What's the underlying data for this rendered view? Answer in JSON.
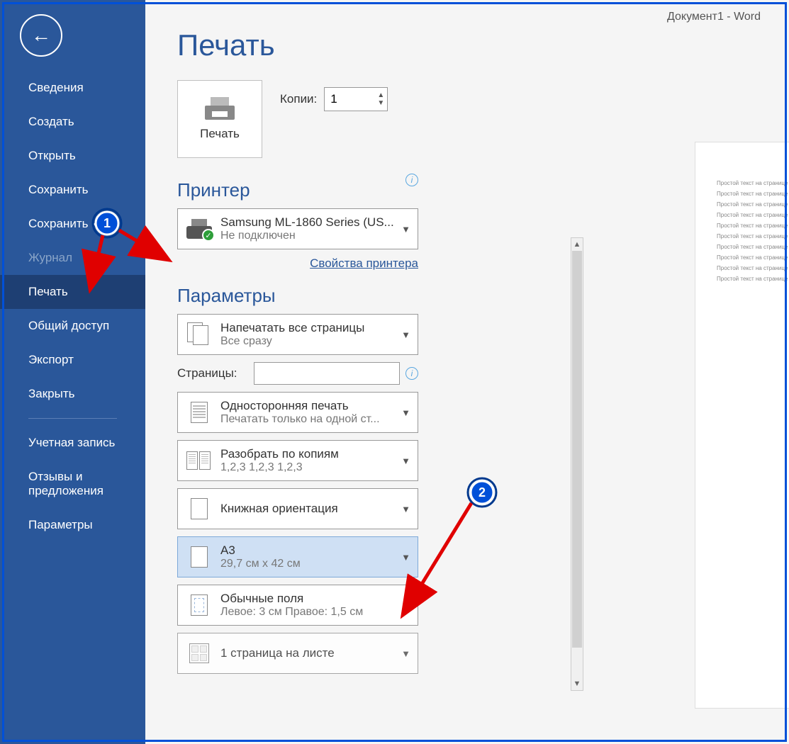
{
  "titlebar": {
    "text": "Документ1  -  Word"
  },
  "page_title": "Печать",
  "sidebar": {
    "items": [
      {
        "label": "Сведения",
        "active": false
      },
      {
        "label": "Создать",
        "active": false
      },
      {
        "label": "Открыть",
        "active": false
      },
      {
        "label": "Сохранить",
        "active": false
      },
      {
        "label": "Сохранить как",
        "active": false
      },
      {
        "label": "Журнал",
        "active": false,
        "disabled": true
      },
      {
        "label": "Печать",
        "active": true
      },
      {
        "label": "Общий доступ",
        "active": false
      },
      {
        "label": "Экспорт",
        "active": false
      },
      {
        "label": "Закрыть",
        "active": false
      }
    ],
    "footer": [
      {
        "label": "Учетная запись"
      },
      {
        "label": "Отзывы и предложения"
      },
      {
        "label": "Параметры"
      }
    ]
  },
  "print_button": {
    "label": "Печать"
  },
  "copies": {
    "label": "Копии:",
    "value": "1"
  },
  "printer_section": {
    "header": "Принтер",
    "name": "Samsung ML-1860 Series (US...",
    "status": "Не подключен",
    "properties_link": "Свойства принтера"
  },
  "settings_section": {
    "header": "Параметры"
  },
  "settings": {
    "print_range": {
      "primary": "Напечатать все страницы",
      "secondary": "Все сразу"
    },
    "pages": {
      "label": "Страницы:",
      "value": ""
    },
    "duplex": {
      "primary": "Односторонняя печать",
      "secondary": "Печатать только на одной ст..."
    },
    "collate": {
      "primary": "Разобрать по копиям",
      "secondary": "1,2,3    1,2,3    1,2,3"
    },
    "orientation": {
      "primary": "Книжная ориентация",
      "secondary": ""
    },
    "paper": {
      "primary": "A3",
      "secondary": "29,7 см x 42 см"
    },
    "margins": {
      "primary": "Обычные поля",
      "secondary": "Левое:  3 см    Правое:  1,5 см"
    },
    "ppp": {
      "primary": "1 страница на листе",
      "secondary": ""
    }
  },
  "preview": {
    "line": "Простой текст на странице",
    "lines": 10
  },
  "callouts": {
    "c1": "1",
    "c2": "2"
  }
}
